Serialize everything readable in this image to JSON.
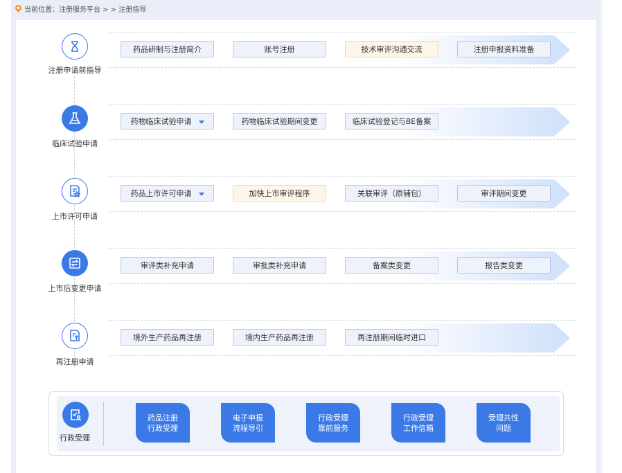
{
  "breadcrumb": {
    "prefix": "当前位置：",
    "path": "注册服务平台 > > 注册指导"
  },
  "colors": {
    "accent": "#3b7ae6",
    "button_bg": "#eef3fb",
    "button_warm_bg": "#fdf5e8",
    "page_bg": "#e9eef8"
  },
  "sections": [
    {
      "label": "注册申请前指导",
      "icon": "hourglass-icon",
      "buttons": [
        "药品研制与注册简介",
        "账号注册",
        "技术审评沟通交流",
        "注册申报资料准备"
      ]
    },
    {
      "label": "临床试验申请",
      "icon": "flask-icon",
      "buttons": [
        "药物临床试验申请",
        "药物临床试验期间变更",
        "临床试验登记与BE备案"
      ]
    },
    {
      "label": "上市许可申请",
      "icon": "document-star-icon",
      "buttons": [
        "药品上市许可申请",
        "加快上市审评程序",
        "关联审评（原辅包）",
        "审评期间变更"
      ]
    },
    {
      "label": "上市后变更申请",
      "icon": "swap-icon",
      "buttons": [
        "审评类补充申请",
        "审批类补充申请",
        "备案类变更",
        "报告类变更"
      ]
    },
    {
      "label": "再注册申请",
      "icon": "document-upload-icon",
      "buttons": [
        "境外生产药品再注册",
        "境内生产药品再注册",
        "再注册期间临时进口"
      ]
    }
  ],
  "admin": {
    "label": "行政受理",
    "icon": "checklist-user-icon",
    "tiles": [
      {
        "line1": "药品注册",
        "line2": "行政受理"
      },
      {
        "line1": "电子申报",
        "line2": "流程导引"
      },
      {
        "line1": "行政受理",
        "line2": "靠前服务"
      },
      {
        "line1": "行政受理",
        "line2": "工作信箱"
      },
      {
        "line1": "受理共性",
        "line2": "问题"
      }
    ]
  }
}
